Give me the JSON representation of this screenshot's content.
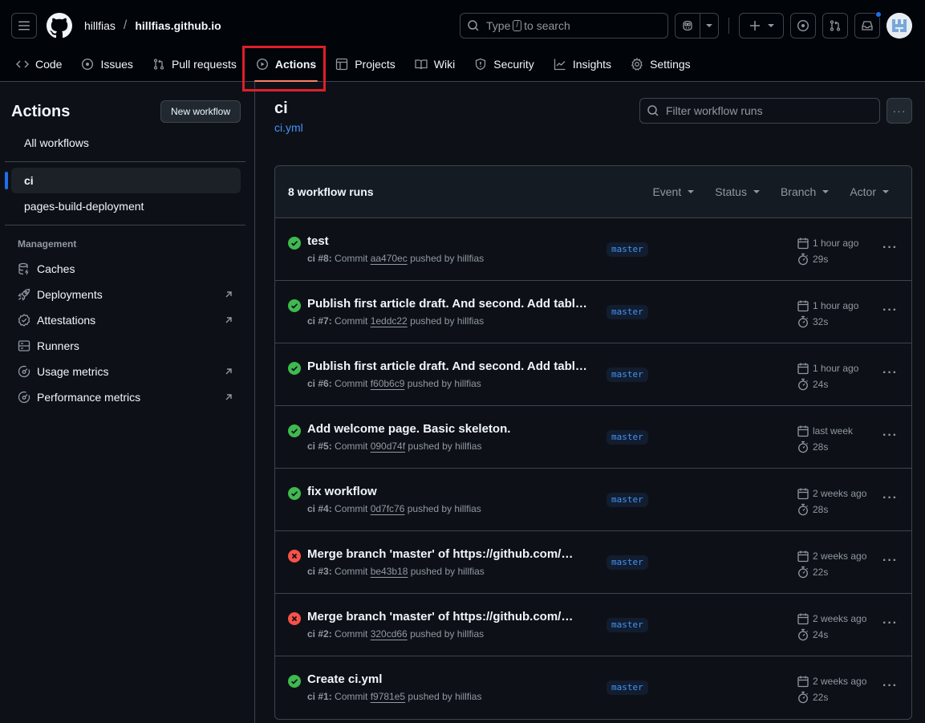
{
  "header": {
    "owner": "hillfias",
    "separator": "/",
    "repo": "hillfias.github.io",
    "search": {
      "prefix": "Type",
      "key": "/",
      "suffix": "to search"
    }
  },
  "nav": [
    {
      "label": "Code",
      "icon": "code-icon"
    },
    {
      "label": "Issues",
      "icon": "issue-icon"
    },
    {
      "label": "Pull requests",
      "icon": "pull-request-icon"
    },
    {
      "label": "Actions",
      "icon": "play-icon",
      "active": true
    },
    {
      "label": "Projects",
      "icon": "table-icon"
    },
    {
      "label": "Wiki",
      "icon": "book-icon"
    },
    {
      "label": "Security",
      "icon": "shield-icon"
    },
    {
      "label": "Insights",
      "icon": "graph-icon"
    },
    {
      "label": "Settings",
      "icon": "gear-icon"
    }
  ],
  "sidebar": {
    "title": "Actions",
    "new_workflow": "New workflow",
    "all_workflows": "All workflows",
    "workflows": [
      {
        "label": "ci",
        "selected": true
      },
      {
        "label": "pages-build-deployment"
      }
    ],
    "management_title": "Management",
    "management": [
      {
        "label": "Caches",
        "icon": "database-icon",
        "external": false
      },
      {
        "label": "Deployments",
        "icon": "rocket-icon",
        "external": true
      },
      {
        "label": "Attestations",
        "icon": "verified-icon",
        "external": true
      },
      {
        "label": "Runners",
        "icon": "server-icon",
        "external": false
      },
      {
        "label": "Usage metrics",
        "icon": "meter-icon",
        "external": true
      },
      {
        "label": "Performance metrics",
        "icon": "meter-icon",
        "external": true
      }
    ]
  },
  "main": {
    "title": "ci",
    "file": "ci.yml",
    "filter_placeholder": "Filter workflow runs",
    "more": "···",
    "runs_count": "8 workflow runs",
    "filters": [
      "Event",
      "Status",
      "Branch",
      "Actor"
    ],
    "runs": [
      {
        "status": "success",
        "title": "test",
        "wf": "ci #8",
        "commit": "aa470ec",
        "by": "hillfias",
        "branch": "master",
        "when": "1 hour ago",
        "duration": "29s"
      },
      {
        "status": "success",
        "title": "Publish first article draft. And second. Add tabl…",
        "wf": "ci #7",
        "commit": "1eddc22",
        "by": "hillfias",
        "branch": "master",
        "when": "1 hour ago",
        "duration": "32s"
      },
      {
        "status": "success",
        "title": "Publish first article draft. And second. Add tabl…",
        "wf": "ci #6",
        "commit": "f60b6c9",
        "by": "hillfias",
        "branch": "master",
        "when": "1 hour ago",
        "duration": "24s"
      },
      {
        "status": "success",
        "title": "Add welcome page. Basic skeleton.",
        "wf": "ci #5",
        "commit": "090d74f",
        "by": "hillfias",
        "branch": "master",
        "when": "last week",
        "duration": "28s"
      },
      {
        "status": "success",
        "title": "fix workflow",
        "wf": "ci #4",
        "commit": "0d7fc76",
        "by": "hillfias",
        "branch": "master",
        "when": "2 weeks ago",
        "duration": "28s"
      },
      {
        "status": "failure",
        "title": "Merge branch 'master' of https://github.com/…",
        "wf": "ci #3",
        "commit": "be43b18",
        "by": "hillfias",
        "branch": "master",
        "when": "2 weeks ago",
        "duration": "22s"
      },
      {
        "status": "failure",
        "title": "Merge branch 'master' of https://github.com/…",
        "wf": "ci #2",
        "commit": "320cd66",
        "by": "hillfias",
        "branch": "master",
        "when": "2 weeks ago",
        "duration": "24s"
      },
      {
        "status": "success",
        "title": "Create ci.yml",
        "wf": "ci #1",
        "commit": "f9781e5",
        "by": "hillfias",
        "branch": "master",
        "when": "2 weeks ago",
        "duration": "22s"
      }
    ]
  },
  "colors": {
    "success": "#3fb950",
    "failure": "#f85149",
    "accent": "#4493f8",
    "active_underline": "#f78166",
    "highlight": "#e11d2b"
  }
}
